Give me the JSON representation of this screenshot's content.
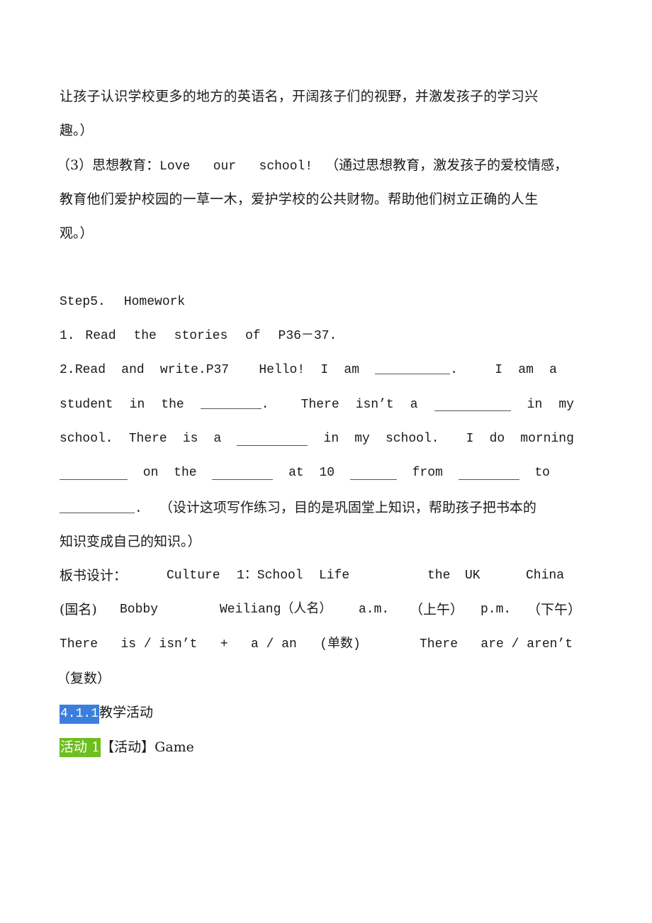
{
  "paragraphs": {
    "p1_line1": "让孩子认识学校更多的地方的英语名，开阔孩子们的视野，并激发孩子的学习兴",
    "p1_line2": "趣。）",
    "p2_label": "（3）思想教育：",
    "p2_en": "Love   our   school!",
    "p2_line1_cn": "（通过思想教育，激发孩子的爱校情感，",
    "p2_line2": "教育他们爱护校园的一草一木，爱护学校的公共财物。帮助他们树立正确的人生",
    "p2_line3": "观。）"
  },
  "homework": {
    "title_step": "Step5.",
    "title_word": "Homework",
    "item1": [
      "1.",
      "Read",
      "the",
      "stories",
      "of",
      "P36－37."
    ],
    "item2_line1": [
      "2.",
      "Read",
      "and",
      "write.P37",
      "Hello!",
      "I",
      "am",
      "__BLANK__.",
      "I",
      "am",
      "a"
    ],
    "item2_line2": [
      "student",
      "in",
      "the",
      "__BLANK__.",
      "There",
      "isn’t",
      "a",
      "__BLANK__",
      "in",
      "my"
    ],
    "item2_line3": [
      "school.",
      "There",
      "is",
      "a",
      "__BLANK__",
      "in",
      "my",
      "school.",
      "I",
      "do",
      "morning"
    ],
    "item2_line4": [
      "__BLANK__",
      "on",
      "the",
      "__BLANK__",
      "at",
      "10",
      "__BLANK__",
      "from",
      "__BLANK__",
      "to"
    ],
    "item2_line5_end": ".",
    "item2_line5_note": "（设计这项写作练习，目的是巩固堂上知识，帮助孩子把书本的",
    "item2_line6": "知识变成自己的知识。）"
  },
  "board": {
    "label": "板书设计：",
    "line1": [
      "Culture",
      "1：School",
      "Life",
      "the",
      "UK",
      "China"
    ],
    "line2": [
      "(国名)",
      "Bobby",
      "Weiliang（人名）",
      "a.m.",
      "（上午）",
      "p.m.",
      "（下午）"
    ],
    "line3_left": "There   is / isn’t   +   a / an   (单数)",
    "line3_right": "There   are / aren’t",
    "line4": "（复数）"
  },
  "section": {
    "number": "4.1.1",
    "title": "教学活动",
    "highlight_color": "#3b7fdc"
  },
  "activity": {
    "label": "活动 1",
    "title": "【活动】Game",
    "highlight_color": "#6cbf1c"
  }
}
